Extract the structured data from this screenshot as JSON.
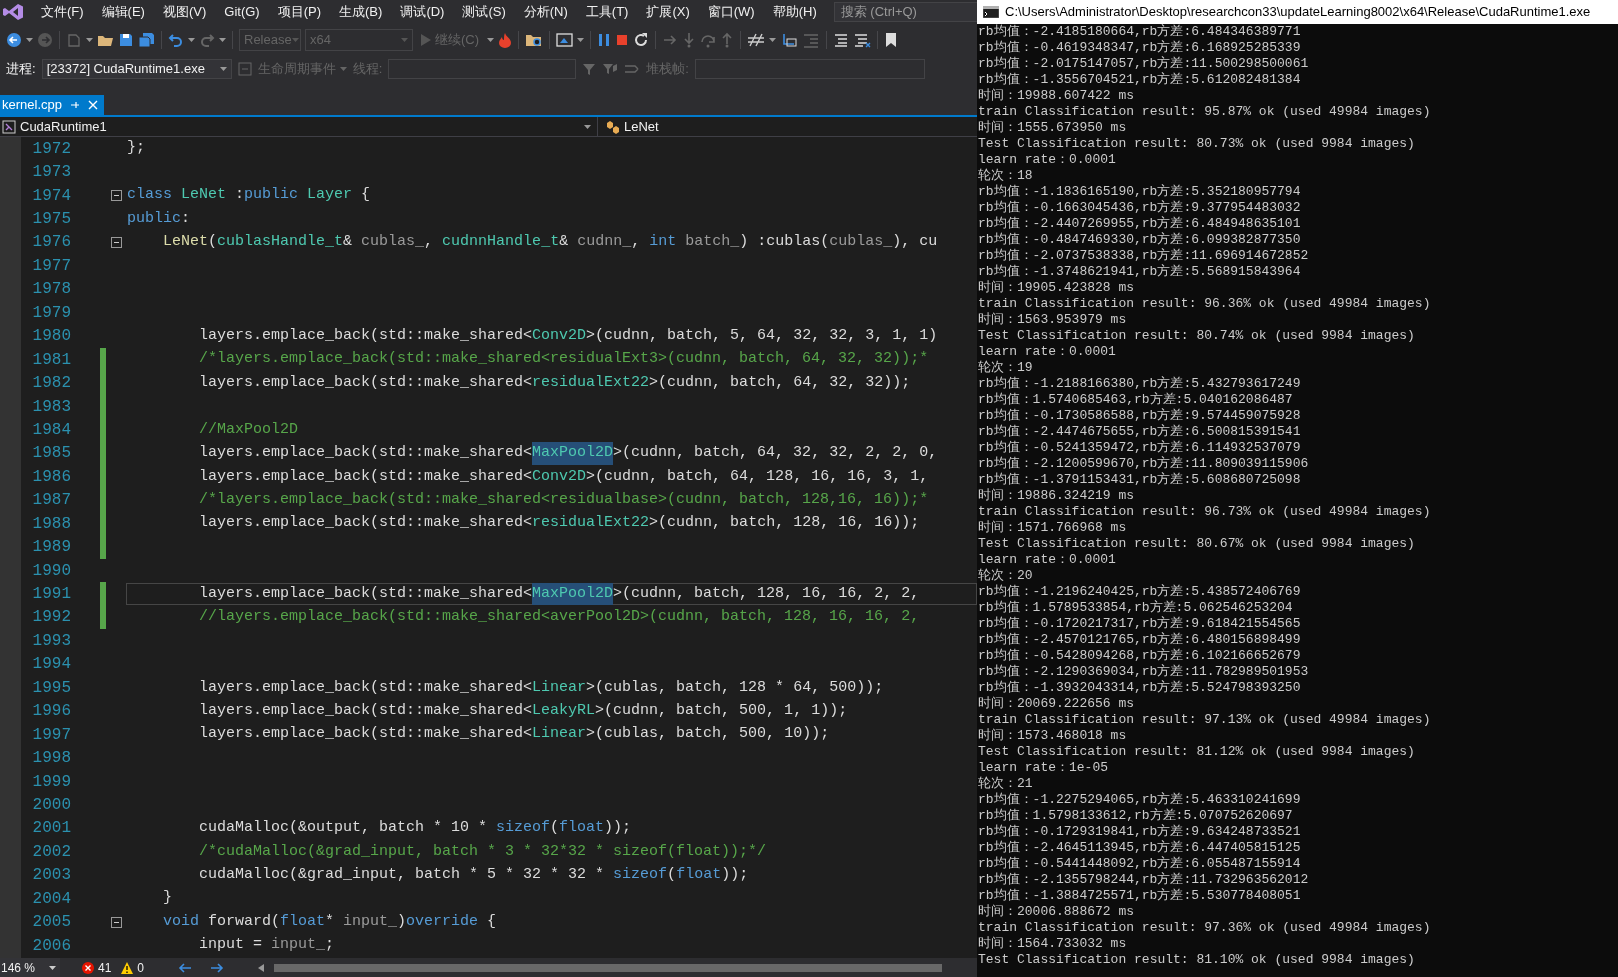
{
  "menu": {
    "items": [
      "文件(F)",
      "编辑(E)",
      "视图(V)",
      "Git(G)",
      "项目(P)",
      "生成(B)",
      "调试(D)",
      "测试(S)",
      "分析(N)",
      "工具(T)",
      "扩展(X)",
      "窗口(W)",
      "帮助(H)"
    ]
  },
  "search": {
    "placeholder": "搜索 (Ctrl+Q)"
  },
  "toolbar": {
    "configuration": {
      "label": "Release",
      "disabled": true
    },
    "platform": {
      "label": "x64",
      "disabled": true
    },
    "continue": {
      "label": "继续(C)",
      "disabled": true
    }
  },
  "debug_bar": {
    "process_label": "进程:",
    "process": "[23372] CudaRuntime1.exe",
    "lifecycle_label": "生命周期事件",
    "thread_label": "线程:",
    "stack_label": "堆栈帧:"
  },
  "tabs": [
    {
      "label": "kernel.cpp",
      "selected": true
    }
  ],
  "nav": {
    "project": "CudaRuntime1",
    "scope": "LeNet"
  },
  "code": {
    "lines": [
      {
        "number": "1972",
        "modified": false,
        "fold": false,
        "current": false,
        "tokens": [
          {
            "text": "};",
            "kind": "plain"
          }
        ]
      },
      {
        "number": "1973",
        "modified": false,
        "fold": false,
        "current": false
      },
      {
        "number": "1974",
        "modified": false,
        "fold": true,
        "current": false,
        "tokens": [
          {
            "text": "class",
            "kind": "keyword"
          },
          {
            "text": " LeNet",
            "kind": "type"
          },
          {
            "text": " :",
            "kind": "plain"
          },
          {
            "text": "public",
            "kind": "keyword"
          },
          {
            "text": " Layer",
            "kind": "type"
          },
          {
            "text": " {",
            "kind": "plain"
          }
        ]
      },
      {
        "number": "1975",
        "modified": false,
        "fold": false,
        "current": false,
        "tokens": [
          {
            "text": "public",
            "kind": "keyword"
          },
          {
            "text": ":",
            "kind": "plain"
          }
        ]
      },
      {
        "number": "1976",
        "modified": false,
        "fold": true,
        "current": false,
        "tokens": [
          {
            "text": "    LeNet",
            "kind": "function"
          },
          {
            "text": "(",
            "kind": "plain"
          },
          {
            "text": "cublasHandle_t",
            "kind": "type"
          },
          {
            "text": "& ",
            "kind": "plain"
          },
          {
            "text": "cublas_",
            "kind": "param"
          },
          {
            "text": ", ",
            "kind": "plain"
          },
          {
            "text": "cudnnHandle_t",
            "kind": "type"
          },
          {
            "text": "& ",
            "kind": "plain"
          },
          {
            "text": "cudnn_",
            "kind": "param"
          },
          {
            "text": ", ",
            "kind": "plain"
          },
          {
            "text": "int",
            "kind": "keyword"
          },
          {
            "text": " batch_",
            "kind": "param"
          },
          {
            "text": ") :cublas(",
            "kind": "plain"
          },
          {
            "text": "cublas_",
            "kind": "param"
          },
          {
            "text": "), ",
            "kind": "plain"
          },
          {
            "text": "cu",
            "kind": "plain"
          }
        ]
      },
      {
        "number": "1977",
        "modified": false,
        "fold": false,
        "current": false
      },
      {
        "number": "1978",
        "modified": false,
        "fold": false,
        "current": false
      },
      {
        "number": "1979",
        "modified": false,
        "fold": false,
        "current": false
      },
      {
        "number": "1980",
        "modified": false,
        "fold": false,
        "current": false,
        "tokens": [
          {
            "text": "        layers.emplace_back(std::make_shared<",
            "kind": "plain"
          },
          {
            "text": "Conv2D",
            "kind": "type"
          },
          {
            "text": ">(cudnn, batch, 5, 64, 32, 32, 3, 1, 1)",
            "kind": "plain"
          }
        ]
      },
      {
        "number": "1981",
        "modified": true,
        "fold": false,
        "current": false,
        "tokens": [
          {
            "text": "        /*layers.emplace_back(std::make_shared<residualExt3>(cudnn, batch, 64, 32, 32));*",
            "kind": "comment"
          }
        ]
      },
      {
        "number": "1982",
        "modified": true,
        "fold": false,
        "current": false,
        "tokens": [
          {
            "text": "        layers.emplace_back(std::make_shared<",
            "kind": "plain"
          },
          {
            "text": "residualExt22",
            "kind": "type"
          },
          {
            "text": ">(cudnn, batch, 64, 32, 32));",
            "kind": "plain"
          }
        ]
      },
      {
        "number": "1983",
        "modified": true,
        "fold": false,
        "current": false
      },
      {
        "number": "1984",
        "modified": true,
        "fold": false,
        "current": false,
        "tokens": [
          {
            "text": "        //MaxPool2D",
            "kind": "comment"
          }
        ]
      },
      {
        "number": "1985",
        "modified": true,
        "fold": false,
        "current": false,
        "tokens": [
          {
            "text": "        layers.emplace_back(std::make_shared<",
            "kind": "plain"
          },
          {
            "text": "MaxPool2D",
            "kind": "highlight"
          },
          {
            "text": ">(cudnn, batch, 64, 32, 32, 2, 2, 0,",
            "kind": "plain"
          }
        ]
      },
      {
        "number": "1986",
        "modified": true,
        "fold": false,
        "current": false,
        "tokens": [
          {
            "text": "        layers.emplace_back(std::make_shared<",
            "kind": "plain"
          },
          {
            "text": "Conv2D",
            "kind": "type"
          },
          {
            "text": ">(cudnn, batch, 64, 128, 16, 16, 3, 1,",
            "kind": "plain"
          }
        ]
      },
      {
        "number": "1987",
        "modified": true,
        "fold": false,
        "current": false,
        "tokens": [
          {
            "text": "        /*layers.emplace_back(std::make_shared<residualbase>(cudnn, batch, 128,16, 16));*",
            "kind": "comment"
          }
        ]
      },
      {
        "number": "1988",
        "modified": true,
        "fold": false,
        "current": false,
        "tokens": [
          {
            "text": "        layers.emplace_back(std::make_shared<",
            "kind": "plain"
          },
          {
            "text": "residualExt22",
            "kind": "type"
          },
          {
            "text": ">(cudnn, batch, 128, 16, 16));",
            "kind": "plain"
          }
        ]
      },
      {
        "number": "1989",
        "modified": true,
        "fold": false,
        "current": false
      },
      {
        "number": "1990",
        "modified": false,
        "fold": false,
        "current": false
      },
      {
        "number": "1991",
        "modified": true,
        "fold": false,
        "current": true,
        "tokens": [
          {
            "text": "        layers.emplace_back(std::make_shared<",
            "kind": "plain"
          },
          {
            "text": "MaxPool2D",
            "kind": "highlight"
          },
          {
            "text": ">(cudnn, batch, 128, 16, 16, 2, 2,",
            "kind": "plain"
          }
        ]
      },
      {
        "number": "1992",
        "modified": true,
        "fold": false,
        "current": false,
        "tokens": [
          {
            "text": "        //layers.emplace_back(std::make_shared<averPool2D>(cudnn, batch, 128, 16, 16, 2,",
            "kind": "comment"
          }
        ]
      },
      {
        "number": "1993",
        "modified": false,
        "fold": false,
        "current": false
      },
      {
        "number": "1994",
        "modified": false,
        "fold": false,
        "current": false
      },
      {
        "number": "1995",
        "modified": false,
        "fold": false,
        "current": false,
        "tokens": [
          {
            "text": "        layers.emplace_back(std::make_shared<",
            "kind": "plain"
          },
          {
            "text": "Linear",
            "kind": "type"
          },
          {
            "text": ">(cublas, batch, 128 * 64, 500));",
            "kind": "plain"
          }
        ]
      },
      {
        "number": "1996",
        "modified": false,
        "fold": false,
        "current": false,
        "tokens": [
          {
            "text": "        layers.emplace_back(std::make_shared<",
            "kind": "plain"
          },
          {
            "text": "LeakyRL",
            "kind": "type"
          },
          {
            "text": ">(cudnn, batch, 500, 1, 1));",
            "kind": "plain"
          }
        ]
      },
      {
        "number": "1997",
        "modified": false,
        "fold": false,
        "current": false,
        "tokens": [
          {
            "text": "        layers.emplace_back(std::make_shared<",
            "kind": "plain"
          },
          {
            "text": "Linear",
            "kind": "type"
          },
          {
            "text": ">(cublas, batch, 500, 10));",
            "kind": "plain"
          }
        ]
      },
      {
        "number": "1998",
        "modified": false,
        "fold": false,
        "current": false
      },
      {
        "number": "1999",
        "modified": false,
        "fold": false,
        "current": false
      },
      {
        "number": "2000",
        "modified": false,
        "fold": false,
        "current": false
      },
      {
        "number": "2001",
        "modified": false,
        "fold": false,
        "current": false,
        "tokens": [
          {
            "text": "        cudaMalloc(&output, batch * 10 * ",
            "kind": "plain"
          },
          {
            "text": "sizeof",
            "kind": "keyword"
          },
          {
            "text": "(",
            "kind": "plain"
          },
          {
            "text": "float",
            "kind": "keyword"
          },
          {
            "text": "));",
            "kind": "plain"
          }
        ]
      },
      {
        "number": "2002",
        "modified": false,
        "fold": false,
        "current": false,
        "tokens": [
          {
            "text": "        /*cudaMalloc(&grad_input, batch * 3 * 32*32 * sizeof(float));*/",
            "kind": "comment"
          }
        ]
      },
      {
        "number": "2003",
        "modified": false,
        "fold": false,
        "current": false,
        "tokens": [
          {
            "text": "        cudaMalloc(&grad_input, batch * 5 * 32 * 32 * ",
            "kind": "plain"
          },
          {
            "text": "sizeof",
            "kind": "keyword"
          },
          {
            "text": "(",
            "kind": "plain"
          },
          {
            "text": "float",
            "kind": "keyword"
          },
          {
            "text": "));",
            "kind": "plain"
          }
        ]
      },
      {
        "number": "2004",
        "modified": false,
        "fold": false,
        "current": false,
        "tokens": [
          {
            "text": "    }",
            "kind": "plain"
          }
        ]
      },
      {
        "number": "2005",
        "modified": false,
        "fold": true,
        "current": false,
        "tokens": [
          {
            "text": "    void",
            "kind": "keyword"
          },
          {
            "text": " forward(",
            "kind": "plain"
          },
          {
            "text": "float",
            "kind": "keyword"
          },
          {
            "text": "* ",
            "kind": "plain"
          },
          {
            "text": "input_",
            "kind": "param"
          },
          {
            "text": ")",
            "kind": "plain"
          },
          {
            "text": "override",
            "kind": "keyword"
          },
          {
            "text": " {",
            "kind": "plain"
          }
        ]
      },
      {
        "number": "2006",
        "modified": false,
        "fold": false,
        "current": false,
        "tokens": [
          {
            "text": "        input = ",
            "kind": "plain"
          },
          {
            "text": "input_",
            "kind": "param"
          },
          {
            "text": ";",
            "kind": "plain"
          }
        ]
      }
    ]
  },
  "status_bar": {
    "zoom": "146 %",
    "errors": "41",
    "warnings": "0"
  },
  "console": {
    "title": "C:\\Users\\Administrator\\Desktop\\researchcon33\\updateLearning8002\\x64\\Release\\CudaRuntime1.exe",
    "lines": [
      "rb均值：-2.4185180664,rb方差:6.484346389771",
      "rb均值：-0.4619348347,rb方差:6.168925285339",
      "rb均值：-2.0175147057,rb方差:11.500298500061",
      "rb均值：-1.3556704521,rb方差:5.612082481384",
      "时间：19988.607422 ms",
      "train Classification result: 95.87% ok (used 49984 images)",
      "时间：1555.673950 ms",
      "Test Classification result: 80.73% ok (used 9984 images)",
      "learn rate：0.0001",
      "轮次：18",
      "rb均值：-1.1836165190,rb方差:5.352180957794",
      "rb均值：-0.1663045436,rb方差:9.377954483032",
      "rb均值：-2.4407269955,rb方差:6.484948635101",
      "rb均值：-0.4847469330,rb方差:6.099382877350",
      "rb均值：-2.0737538338,rb方差:11.696914672852",
      "rb均值：-1.3748621941,rb方差:5.568915843964",
      "时间：19905.423828 ms",
      "train Classification result: 96.36% ok (used 49984 images)",
      "时间：1563.953979 ms",
      "Test Classification result: 80.74% ok (used 9984 images)",
      "learn rate：0.0001",
      "轮次：19",
      "rb均值：-1.2188166380,rb方差:5.432793617249",
      "rb均值：1.5740685463,rb方差:5.040162086487",
      "rb均值：-0.1730586588,rb方差:9.574459075928",
      "rb均值：-2.4474675655,rb方差:6.500815391541",
      "rb均值：-0.5241359472,rb方差:6.114932537079",
      "rb均值：-2.1200599670,rb方差:11.809039115906",
      "rb均值：-1.3791153431,rb方差:5.608680725098",
      "时间：19886.324219 ms",
      "train Classification result: 96.73% ok (used 49984 images)",
      "时间：1571.766968 ms",
      "Test Classification result: 80.67% ok (used 9984 images)",
      "learn rate：0.0001",
      "轮次：20",
      "rb均值：-1.2196240425,rb方差:5.438572406769",
      "rb均值：1.5789533854,rb方差:5.062546253204",
      "rb均值：-0.1720217317,rb方差:9.618421554565",
      "rb均值：-2.4570121765,rb方差:6.480156898499",
      "rb均值：-0.5428094268,rb方差:6.102166652679",
      "rb均值：-2.1290369034,rb方差:11.782989501953",
      "rb均值：-1.3932043314,rb方差:5.524798393250",
      "时间：20069.222656 ms",
      "train Classification result: 97.13% ok (used 49984 images)",
      "时间：1573.468018 ms",
      "Test Classification result: 81.12% ok (used 9984 images)",
      "learn rate：1e-05",
      "轮次：21",
      "rb均值：-1.2275294065,rb方差:5.463310241699",
      "rb均值：1.5798133612,rb方差:5.070752620697",
      "rb均值：-0.1729319841,rb方差:9.634248733521",
      "rb均值：-2.4645113945,rb方差:6.447405815125",
      "rb均值：-0.5441448092,rb方差:6.055487155914",
      "rb均值：-2.1355798244,rb方差:11.732963562012",
      "rb均值：-1.3884725571,rb方差:5.530778408051",
      "时间：20006.888672 ms",
      "train Classification result: 97.36% ok (used 49984 images)",
      "时间：1564.733032 ms",
      "Test Classification result: 81.10% ok (used 9984 images)"
    ]
  }
}
